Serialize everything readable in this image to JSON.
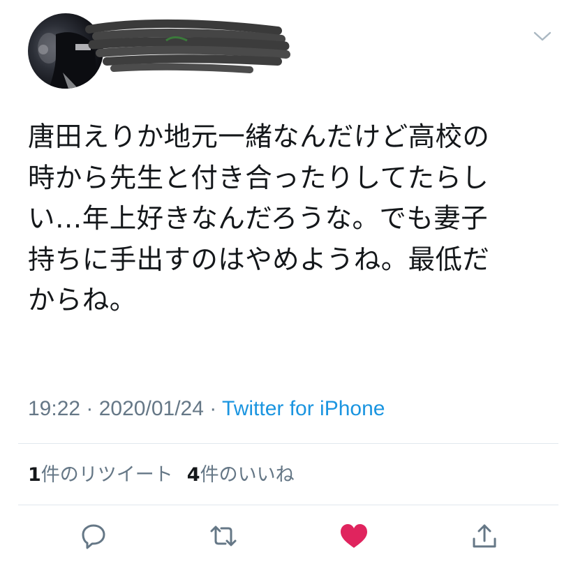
{
  "header": {
    "avatar_icon": "profile-avatar",
    "menu_icon": "chevron-down-icon"
  },
  "tweet": {
    "lines": [
      "唐田えりか地元一緒なんだけど高校の",
      "時から先生と付き合ったりしてたらし",
      "い…年上好きなんだろうな。でも妻子",
      "持ちに手出すのはやめようね。最低だ",
      "からね。"
    ]
  },
  "meta": {
    "time": "19:22",
    "separator": " · ",
    "date": "2020/01/24",
    "source": "Twitter for iPhone"
  },
  "stats": {
    "retweet_count": "1",
    "retweet_label": "件のリツイート",
    "like_count": "4",
    "like_label": "件のいいね"
  },
  "actions": {
    "reply_icon": "reply-icon",
    "retweet_icon": "retweet-icon",
    "like_icon": "heart-icon",
    "share_icon": "share-icon"
  },
  "colors": {
    "text": "#14171a",
    "secondary": "#657786",
    "link": "#1b95e0",
    "like": "#e0245e",
    "divider": "#e1e8ed"
  }
}
